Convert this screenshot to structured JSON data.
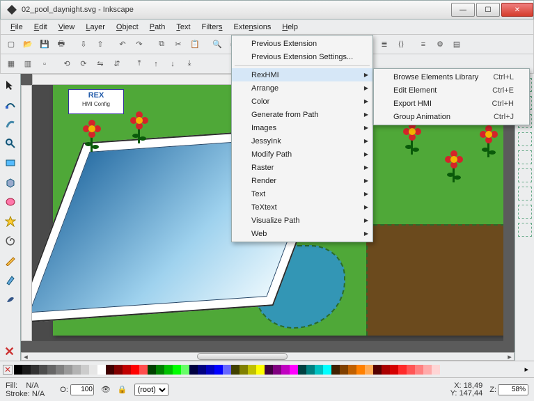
{
  "window": {
    "title": "02_pool_daynight.svg - Inkscape"
  },
  "menubar": [
    "File",
    "Edit",
    "View",
    "Layer",
    "Object",
    "Path",
    "Text",
    "Filters",
    "Extensions",
    "Help"
  ],
  "ext_menu": {
    "top": [
      "Previous Extension",
      "Previous Extension Settings..."
    ],
    "items": [
      "RexHMI",
      "Arrange",
      "Color",
      "Generate from Path",
      "Images",
      "JessyInk",
      "Modify Path",
      "Raster",
      "Render",
      "Text",
      "TeXtext",
      "Visualize Path",
      "Web"
    ],
    "highlighted": "RexHMI"
  },
  "sub_menu": [
    {
      "label": "Browse Elements Library",
      "shortcut": "Ctrl+L"
    },
    {
      "label": "Edit Element",
      "shortcut": "Ctrl+E"
    },
    {
      "label": "Export HMI",
      "shortcut": "Ctrl+H"
    },
    {
      "label": "Group Animation",
      "shortcut": "Ctrl+J"
    }
  ],
  "rexlogo": {
    "title": "REX",
    "subtitle": "HMI Config"
  },
  "status": {
    "fill_label": "Fill:",
    "fill_value": "N/A",
    "stroke_label": "Stroke:",
    "stroke_value": "N/A",
    "opacity_label": "O:",
    "opacity_value": "100",
    "layer_label": "(root)",
    "x_label": "X:",
    "x_value": "18,49",
    "y_label": "Y:",
    "y_value": "147,44",
    "zoom_label": "Z:",
    "zoom_value": "58%"
  },
  "palette": [
    "#000000",
    "#1a1a1a",
    "#333333",
    "#4d4d4d",
    "#666666",
    "#808080",
    "#999999",
    "#b3b3b3",
    "#cccccc",
    "#e6e6e6",
    "#ffffff",
    "#400000",
    "#800000",
    "#c00000",
    "#ff0000",
    "#ff4d4d",
    "#004000",
    "#008000",
    "#00c000",
    "#00ff00",
    "#66ff66",
    "#000040",
    "#000080",
    "#0000c0",
    "#0000ff",
    "#6666ff",
    "#404000",
    "#808000",
    "#c0c000",
    "#ffff00",
    "#400040",
    "#800080",
    "#c000c0",
    "#ff00ff",
    "#004040",
    "#008080",
    "#00c0c0",
    "#00ffff",
    "#402000",
    "#804000",
    "#c06000",
    "#ff8000",
    "#ffaa55",
    "#550000",
    "#aa0000",
    "#d40000",
    "#ff2a2a",
    "#ff5555",
    "#ff8080",
    "#ffaaaa",
    "#ffd5d5"
  ]
}
